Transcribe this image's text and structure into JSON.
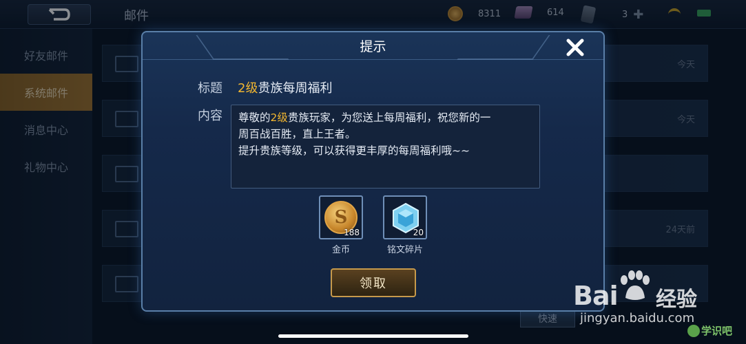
{
  "topbar": {
    "title": "邮件",
    "gold": "8311",
    "gems": "614",
    "cards": "3"
  },
  "sidebar": {
    "items": [
      {
        "label": "好友邮件"
      },
      {
        "label": "系统邮件"
      },
      {
        "label": "消息中心"
      },
      {
        "label": "礼物中心"
      }
    ]
  },
  "mail_list": {
    "dates": [
      "今天",
      "今天",
      "24天前"
    ],
    "quick_button": "快速"
  },
  "dialog": {
    "title": "提示",
    "subject_label": "标题",
    "subject_highlight": "2级",
    "subject_rest": "贵族每周福利",
    "content_label": "内容",
    "content_prefix": "尊敬的",
    "content_highlight": "2级",
    "content_line1_rest": "贵族玩家，为您送上每周福利，祝您新的一",
    "content_line2": "周百战百胜，直上王者。",
    "content_line3": "提升贵族等级，可以获得更丰厚的每周福利哦~~",
    "rewards": [
      {
        "name": "金币",
        "count": "188",
        "icon": "gold-coin-icon"
      },
      {
        "name": "铭文碎片",
        "count": "20",
        "icon": "crystal-icon"
      }
    ],
    "claim_label": "领取"
  },
  "watermark": {
    "brand": "Bai",
    "brand2": "经验",
    "url": "jingyan.baidu.com",
    "badge": "学识吧"
  },
  "colors": {
    "highlight": "#f2b630",
    "active_tab": "#a07431",
    "dialog_border": "#5a7fa8"
  }
}
